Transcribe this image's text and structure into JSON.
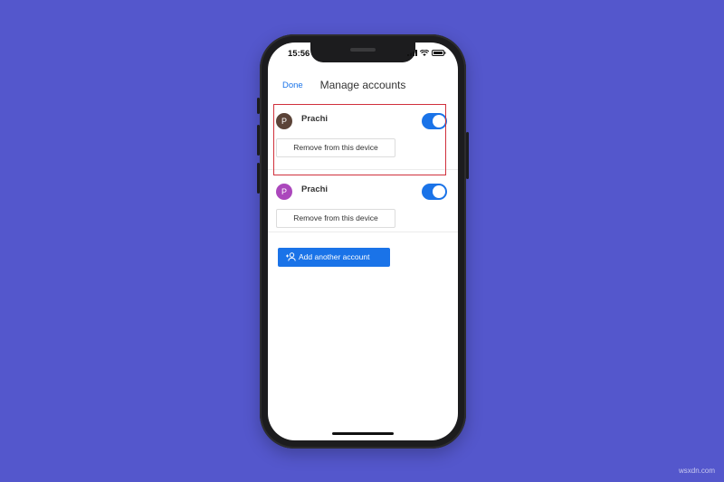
{
  "status_bar": {
    "time": "15:56"
  },
  "nav": {
    "done_label": "Done",
    "title": "Manage accounts"
  },
  "accounts": [
    {
      "initial": "P",
      "name": "Prachi",
      "toggle_on": true,
      "remove_label": "Remove from this device",
      "avatar_color": "#5b4338",
      "highlighted": true
    },
    {
      "initial": "P",
      "name": "Prachi",
      "toggle_on": true,
      "remove_label": "Remove from this device",
      "avatar_color": "#ab47bc",
      "highlighted": false
    }
  ],
  "add_account_label": "Add another account",
  "colors": {
    "background": "#5457cc",
    "accent": "#1a73e8",
    "highlight": "#d0303c"
  },
  "watermark": "wsxdn.com"
}
